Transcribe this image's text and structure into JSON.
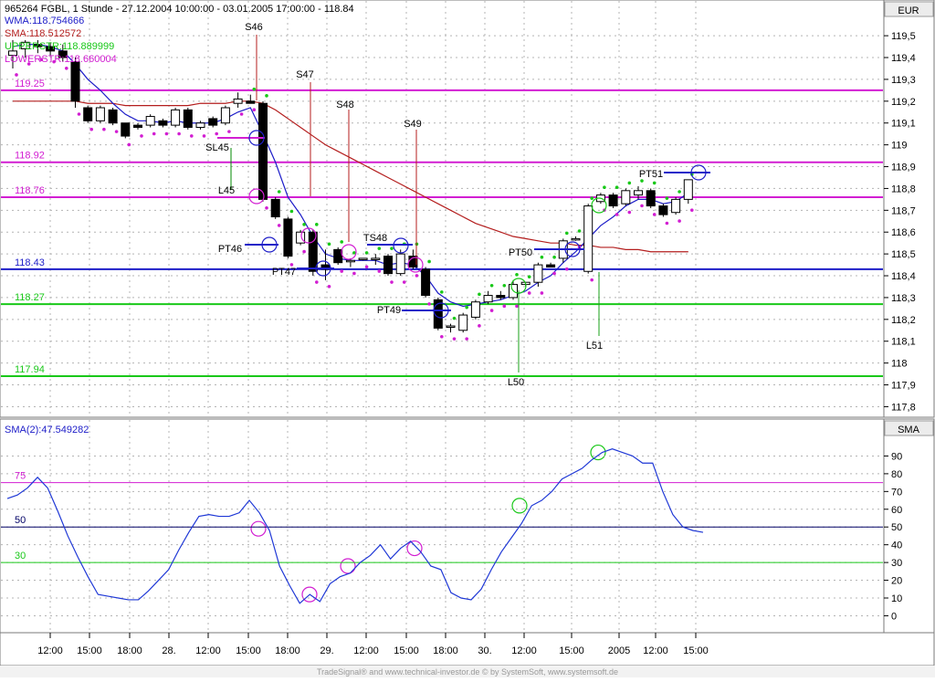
{
  "header": {
    "line1": "965264  FGBL, 1 Stunde - 27.12.2004 10:00:00 - 03.01.2005 17:00:00 - 118.84",
    "line2": "WMA:118.754666",
    "line3": "SMA:118.512572",
    "line4": "UPPERSTR:118.889999",
    "line5": "LOWERSTR:118.660004",
    "currency": "EUR"
  },
  "colors": {
    "wma": "#1c1cc8",
    "sma": "#b41e1e",
    "upper_green": "#19c819",
    "lower_magenta": "#d21ed2",
    "blue_level": "#1e1ec8",
    "osc_line": "#1f38d6",
    "grid": "#b4b4b4"
  },
  "chart_data": [
    {
      "type": "candlestick",
      "title": "965264  FGBL, 1 Stunde",
      "yaxis": {
        "ticks": [
          "119,5",
          "119,4",
          "119,3",
          "119,2",
          "119,1",
          "119",
          "118,9",
          "118,8",
          "118,7",
          "118,6",
          "118,5",
          "118,4",
          "118,3",
          "118,2",
          "118,1",
          "118",
          "117,9",
          "117,8"
        ],
        "ylim": [
          117.76,
          119.58
        ],
        "side": "right"
      },
      "xaxis": {
        "ticks": [
          "12:00",
          "15:00",
          "18:00",
          "28.",
          "12:00",
          "15:00",
          "18:00",
          "29.",
          "12:00",
          "15:00",
          "18:00",
          "30.",
          "12:00",
          "15:00",
          "2005",
          "12:00",
          "15:00"
        ]
      },
      "horizontal_levels": [
        {
          "label": "119.25",
          "value": 119.25,
          "color_key": "lower_magenta"
        },
        {
          "label": "118.92",
          "value": 118.92,
          "color_key": "lower_magenta"
        },
        {
          "label": "118.76",
          "value": 118.76,
          "color_key": "lower_magenta"
        },
        {
          "label": "118.43",
          "value": 118.43,
          "color_key": "blue_level"
        },
        {
          "label": "118.27",
          "value": 118.27,
          "color_key": "upper_green"
        },
        {
          "label": "117.94",
          "value": 117.94,
          "color_key": "upper_green"
        }
      ],
      "candles": [
        {
          "o": 119.41,
          "h": 119.48,
          "l": 119.35,
          "c": 119.43
        },
        {
          "o": 119.44,
          "h": 119.48,
          "l": 119.4,
          "c": 119.47
        },
        {
          "o": 119.46,
          "h": 119.48,
          "l": 119.42,
          "c": 119.45
        },
        {
          "o": 119.45,
          "h": 119.47,
          "l": 119.41,
          "c": 119.43
        },
        {
          "o": 119.43,
          "h": 119.46,
          "l": 119.38,
          "c": 119.4
        },
        {
          "o": 119.38,
          "h": 119.4,
          "l": 119.17,
          "c": 119.2
        },
        {
          "o": 119.17,
          "h": 119.18,
          "l": 119.1,
          "c": 119.11
        },
        {
          "o": 119.11,
          "h": 119.18,
          "l": 119.1,
          "c": 119.17
        },
        {
          "o": 119.16,
          "h": 119.17,
          "l": 119.09,
          "c": 119.1
        },
        {
          "o": 119.1,
          "h": 119.1,
          "l": 119.03,
          "c": 119.04
        },
        {
          "o": 119.09,
          "h": 119.1,
          "l": 119.07,
          "c": 119.08
        },
        {
          "o": 119.09,
          "h": 119.14,
          "l": 119.08,
          "c": 119.13
        },
        {
          "o": 119.11,
          "h": 119.12,
          "l": 119.08,
          "c": 119.09
        },
        {
          "o": 119.09,
          "h": 119.17,
          "l": 119.08,
          "c": 119.16
        },
        {
          "o": 119.16,
          "h": 119.17,
          "l": 119.07,
          "c": 119.08
        },
        {
          "o": 119.08,
          "h": 119.11,
          "l": 119.07,
          "c": 119.1
        },
        {
          "o": 119.12,
          "h": 119.13,
          "l": 119.08,
          "c": 119.09
        },
        {
          "o": 119.1,
          "h": 119.18,
          "l": 119.09,
          "c": 119.17
        },
        {
          "o": 119.19,
          "h": 119.24,
          "l": 119.17,
          "c": 119.21
        },
        {
          "o": 119.2,
          "h": 119.23,
          "l": 119.19,
          "c": 119.19
        },
        {
          "o": 119.19,
          "h": 119.2,
          "l": 118.74,
          "c": 118.75
        },
        {
          "o": 118.75,
          "h": 118.76,
          "l": 118.66,
          "c": 118.67
        },
        {
          "o": 118.66,
          "h": 118.67,
          "l": 118.48,
          "c": 118.49
        },
        {
          "o": 118.55,
          "h": 118.61,
          "l": 118.54,
          "c": 118.6
        },
        {
          "o": 118.6,
          "h": 118.61,
          "l": 118.4,
          "c": 118.42
        },
        {
          "o": 118.45,
          "h": 118.52,
          "l": 118.38,
          "c": 118.43
        },
        {
          "o": 118.52,
          "h": 118.53,
          "l": 118.45,
          "c": 118.46
        },
        {
          "o": 118.47,
          "h": 118.48,
          "l": 118.44,
          "c": 118.47
        },
        {
          "o": 118.48,
          "h": 118.48,
          "l": 118.47,
          "c": 118.48
        },
        {
          "o": 118.48,
          "h": 118.5,
          "l": 118.45,
          "c": 118.48
        },
        {
          "o": 118.49,
          "h": 118.5,
          "l": 118.4,
          "c": 118.41
        },
        {
          "o": 118.41,
          "h": 118.52,
          "l": 118.4,
          "c": 118.5
        },
        {
          "o": 118.49,
          "h": 118.52,
          "l": 118.43,
          "c": 118.44
        },
        {
          "o": 118.43,
          "h": 118.44,
          "l": 118.3,
          "c": 118.31
        },
        {
          "o": 118.29,
          "h": 118.3,
          "l": 118.15,
          "c": 118.16
        },
        {
          "o": 118.17,
          "h": 118.18,
          "l": 118.14,
          "c": 118.17
        },
        {
          "o": 118.15,
          "h": 118.23,
          "l": 118.14,
          "c": 118.22
        },
        {
          "o": 118.21,
          "h": 118.29,
          "l": 118.2,
          "c": 118.28
        },
        {
          "o": 118.28,
          "h": 118.33,
          "l": 118.27,
          "c": 118.31
        },
        {
          "o": 118.31,
          "h": 118.33,
          "l": 118.29,
          "c": 118.3
        },
        {
          "o": 118.3,
          "h": 118.38,
          "l": 118.29,
          "c": 118.36
        },
        {
          "o": 118.36,
          "h": 118.37,
          "l": 118.35,
          "c": 118.37
        },
        {
          "o": 118.37,
          "h": 118.46,
          "l": 118.35,
          "c": 118.45
        },
        {
          "o": 118.45,
          "h": 118.46,
          "l": 118.44,
          "c": 118.44
        },
        {
          "o": 118.48,
          "h": 118.57,
          "l": 118.46,
          "c": 118.56
        },
        {
          "o": 118.57,
          "h": 118.58,
          "l": 118.56,
          "c": 118.57
        },
        {
          "o": 118.42,
          "h": 118.73,
          "l": 118.41,
          "c": 118.72
        },
        {
          "o": 118.74,
          "h": 118.78,
          "l": 118.73,
          "c": 118.77
        },
        {
          "o": 118.77,
          "h": 118.78,
          "l": 118.71,
          "c": 118.72
        },
        {
          "o": 118.73,
          "h": 118.8,
          "l": 118.72,
          "c": 118.79
        },
        {
          "o": 118.77,
          "h": 118.81,
          "l": 118.75,
          "c": 118.79
        },
        {
          "o": 118.79,
          "h": 118.8,
          "l": 118.71,
          "c": 118.72
        },
        {
          "o": 118.72,
          "h": 118.73,
          "l": 118.67,
          "c": 118.68
        },
        {
          "o": 118.69,
          "h": 118.76,
          "l": 118.68,
          "c": 118.75
        },
        {
          "o": 118.75,
          "h": 118.84,
          "l": 118.73,
          "c": 118.84
        }
      ],
      "wma": [
        119.45,
        119.46,
        119.46,
        119.45,
        119.43,
        119.37,
        119.3,
        119.25,
        119.19,
        119.14,
        119.11,
        119.11,
        119.1,
        119.11,
        119.1,
        119.1,
        119.1,
        119.12,
        119.15,
        119.17,
        119.05,
        118.92,
        118.76,
        118.68,
        118.58,
        118.5,
        118.48,
        118.47,
        118.47,
        118.47,
        118.45,
        118.46,
        118.45,
        118.4,
        118.32,
        118.28,
        118.26,
        118.27,
        118.28,
        118.29,
        118.31,
        118.33,
        118.37,
        118.4,
        118.46,
        118.51,
        118.57,
        118.63,
        118.67,
        118.72,
        118.75,
        118.75,
        118.73,
        118.74,
        118.78
      ],
      "sma": [
        119.2,
        119.2,
        119.2,
        119.2,
        119.2,
        119.2,
        119.19,
        119.19,
        119.19,
        119.18,
        119.18,
        119.18,
        119.18,
        119.18,
        119.18,
        119.19,
        119.19,
        119.19,
        119.2,
        119.2,
        119.19,
        119.16,
        119.12,
        119.08,
        119.04,
        119.0,
        118.97,
        118.94,
        118.91,
        118.88,
        118.85,
        118.82,
        118.79,
        118.76,
        118.73,
        118.7,
        118.67,
        118.64,
        118.62,
        118.6,
        118.58,
        118.57,
        118.56,
        118.55,
        118.55,
        118.54,
        118.54,
        118.53,
        118.53,
        118.52,
        118.52,
        118.51,
        118.51,
        118.51,
        118.51
      ],
      "annotations": [
        {
          "text": "S46"
        },
        {
          "text": "S47"
        },
        {
          "text": "S48"
        },
        {
          "text": "S49"
        },
        {
          "text": "SL45"
        },
        {
          "text": "L45"
        },
        {
          "text": "PT46"
        },
        {
          "text": "PT47"
        },
        {
          "text": "TS48"
        },
        {
          "text": "PT49"
        },
        {
          "text": "PT50"
        },
        {
          "text": "PT51"
        },
        {
          "text": "L50"
        },
        {
          "text": "L51"
        }
      ]
    },
    {
      "type": "line",
      "title": "SMA(2):47.549282",
      "label_right": "SMA",
      "yaxis": {
        "ticks": [
          "90",
          "80",
          "70",
          "60",
          "50",
          "40",
          "30",
          "20",
          "10",
          "0"
        ],
        "ylim": [
          -8,
          100
        ]
      },
      "levels": [
        {
          "label": "75",
          "value": 75,
          "color_key": "lower_magenta"
        },
        {
          "label": "50",
          "value": 50,
          "color": "#000066"
        },
        {
          "label": "30",
          "value": 30,
          "color_key": "upper_green"
        }
      ],
      "values": [
        66,
        68,
        72,
        78,
        72,
        59,
        45,
        33,
        22,
        12,
        11,
        10,
        9,
        9,
        14,
        20,
        26,
        37,
        47,
        56,
        57,
        56,
        56,
        58,
        65,
        58,
        48,
        28,
        17,
        7,
        12,
        8,
        18,
        22,
        24,
        30,
        34,
        40,
        32,
        38,
        42,
        36,
        28,
        26,
        13,
        10,
        9,
        15,
        26,
        36,
        44,
        52,
        62,
        65,
        70,
        77,
        80,
        83,
        88,
        92,
        94,
        92,
        90,
        86,
        86,
        70,
        57,
        50,
        48,
        47
      ]
    }
  ]
}
